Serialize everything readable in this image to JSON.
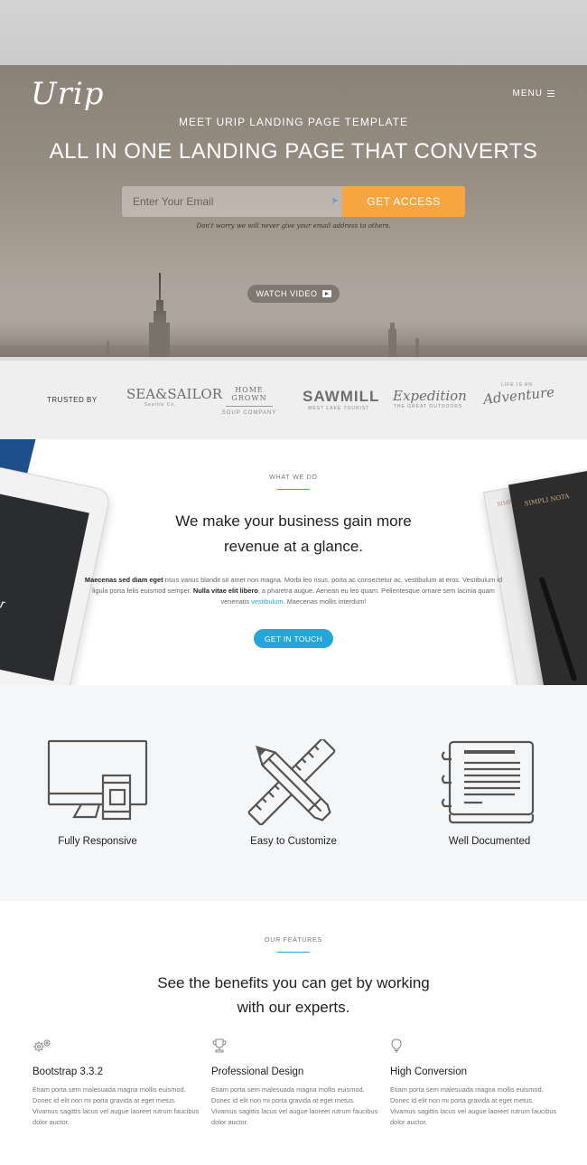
{
  "hero": {
    "logo": "Urip",
    "menu_label": "MENU",
    "pretitle": "MEET URIP LANDING PAGE TEMPLATE",
    "title": "ALL IN ONE LANDING PAGE THAT CONVERTS",
    "email_placeholder": "Enter Your Email",
    "access_button": "GET ACCESS",
    "disclaimer": "Don't worry we will never give your email address to others.",
    "video_button": "WATCH VIDEO"
  },
  "trusted": {
    "label": "TRUSTED BY",
    "logos": [
      {
        "name": "SEA&SAILOR",
        "sub": "Seattle Co."
      },
      {
        "name": "HOME GROWN",
        "sub": "SOUP COMPANY"
      },
      {
        "name": "SAWMILL",
        "sub": "WEST LAKE TOURIST"
      },
      {
        "name": "Expedition",
        "sub": "THE GREAT OUTDOORS"
      },
      {
        "name": "Adventure",
        "sub": "LIFE IS AN"
      }
    ]
  },
  "whatwedo": {
    "tag": "WHAT WE DO",
    "heading_line1": "We make your business gain more",
    "heading_line2": "revenue at a glance.",
    "body_bold1": "Maecenas sed diam eget",
    "body_part1": " risus varius blandit sit amet non magna. Morbi leo risus, porta ac consectetur ac, vestibulum at eros. Vestibulum id ligula porta felis euismod semper. ",
    "body_bold2": "Nulla vitae elit libero",
    "body_part2": ", a pharetra augue. Aenean eu leo quam. Pellentesque ornare sem lacinia quam venenatis ",
    "body_link": "vestibulum",
    "body_part3": ". Maecenas mollis interdum!",
    "button": "GET IN TOUCH",
    "tablet_text": "ver",
    "notebook_text": "SIMPLI NOTA"
  },
  "icons": [
    {
      "label": "Fully Responsive",
      "icon": "devices-icon"
    },
    {
      "label": "Easy to Customize",
      "icon": "pencil-ruler-icon"
    },
    {
      "label": "Well Documented",
      "icon": "notebook-icon"
    }
  ],
  "features": {
    "tag": "OUR FEATURES",
    "heading_line1": "See the benefits you can get by working",
    "heading_line2": "with our experts.",
    "items": [
      {
        "title": "Bootstrap 3.3.2",
        "icon": "gears-icon",
        "desc": "Etiam porta sem malesuada magna mollis euismod. Donec id elit non mi porta gravida at eget metus. Vivamus sagittis lacus vel augue laoreet rutrum faucibus dolor auctor."
      },
      {
        "title": "Professional Design",
        "icon": "trophy-icon",
        "desc": "Etiam porta sem malesuada magna mollis euismod. Donec id elit non mi porta gravida at eget metus. Vivamus sagittis lacus vel augue laoreet rutrum faucibus dolor auctor."
      },
      {
        "title": "High Conversion",
        "icon": "lightbulb-icon",
        "desc": "Etiam porta sem malesuada magna mollis euismod. Donec id elit non mi porta gravida at eget metus. Vivamus sagittis lacus vel augue laoreet rutrum faucibus dolor auctor."
      }
    ]
  },
  "colors": {
    "accent_orange": "#f7a541",
    "accent_blue": "#23a7db"
  }
}
